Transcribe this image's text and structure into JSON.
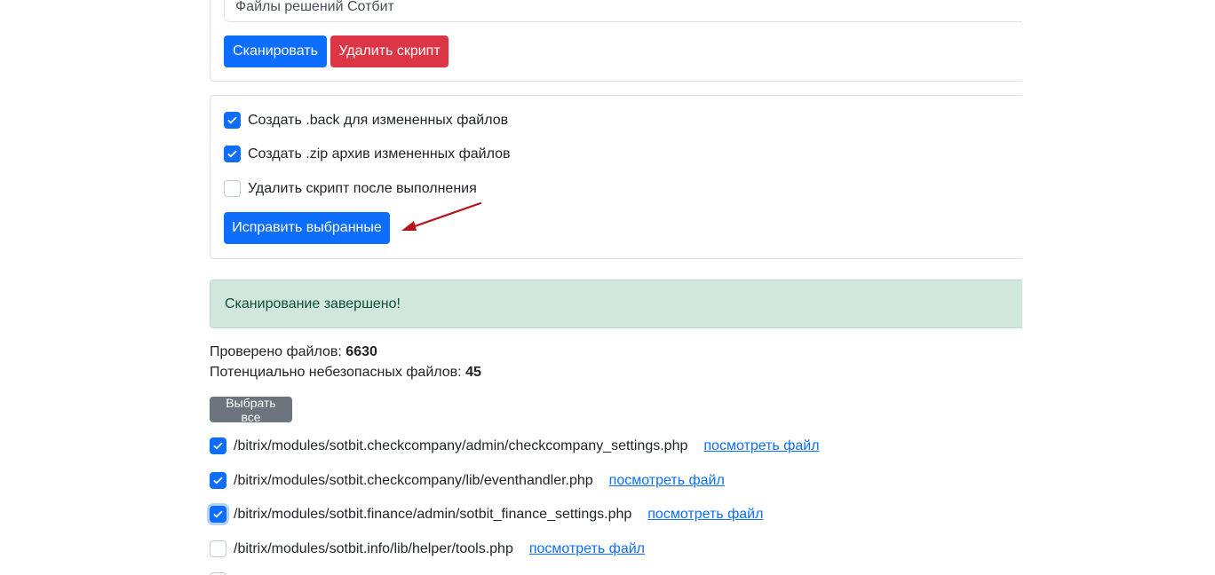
{
  "scan": {
    "field_value": "Файлы решений Сотбит",
    "scan_button": "Сканировать",
    "delete_script_button": "Удалить скрипт"
  },
  "options": {
    "items": [
      {
        "label": "Создать .back для измененных файлов",
        "checked": true
      },
      {
        "label": "Создать .zip архив измененных файлов",
        "checked": true
      },
      {
        "label": "Удалить скрипт после выполнения",
        "checked": false
      }
    ],
    "fix_button": "Исправить выбранные"
  },
  "alert": {
    "message": "Сканирование завершено!"
  },
  "stats": {
    "checked_label": "Проверено файлов: ",
    "checked_value": "6630",
    "unsafe_label": "Потенциально небезопасных файлов: ",
    "unsafe_value": "45"
  },
  "select_all_button": "Выбрать все",
  "files": [
    {
      "path": "/bitrix/modules/sotbit.checkcompany/admin/checkcompany_settings.php",
      "link": "посмотреть файл",
      "checked": true
    },
    {
      "path": "/bitrix/modules/sotbit.checkcompany/lib/eventhandler.php",
      "link": "посмотреть файл",
      "checked": true
    },
    {
      "path": "/bitrix/modules/sotbit.finance/admin/sotbit_finance_settings.php",
      "link": "посмотреть файл",
      "checked": true,
      "focused": true
    },
    {
      "path": "/bitrix/modules/sotbit.info/lib/helper/tools.php",
      "link": "посмотреть файл",
      "checked": false
    }
  ],
  "colors": {
    "primary": "#0d6efd",
    "danger": "#dc3545",
    "secondary": "#6c757d",
    "success_bg": "#d1e7dd",
    "success_text": "#0f5132",
    "annotation_arrow": "#b5141a"
  }
}
